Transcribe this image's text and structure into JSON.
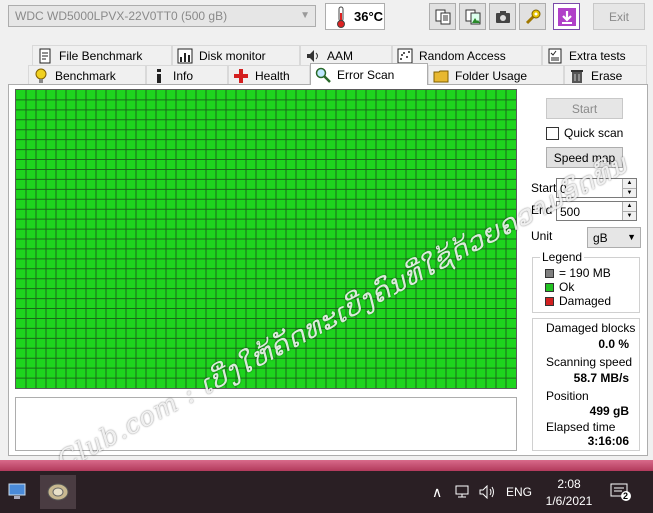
{
  "window": {
    "drive": "WDC WD5000LPVX-22V0TT0 (500 gB)",
    "temperature": "36",
    "temperature_unit": "°C",
    "exit_label": "Exit"
  },
  "tabs_row1": [
    {
      "label": "File Benchmark",
      "icon": "file-benchmark-icon"
    },
    {
      "label": "Disk monitor",
      "icon": "disk-monitor-icon"
    },
    {
      "label": "AAM",
      "icon": "speaker-icon"
    },
    {
      "label": "Random Access",
      "icon": "random-access-icon"
    },
    {
      "label": "Extra tests",
      "icon": "extra-tests-icon"
    }
  ],
  "tabs_row2": [
    {
      "label": "Benchmark",
      "icon": "benchmark-icon"
    },
    {
      "label": "Info",
      "icon": "info-icon"
    },
    {
      "label": "Health",
      "icon": "health-icon"
    },
    {
      "label": "Error Scan",
      "icon": "magnifier-icon",
      "active": true
    },
    {
      "label": "Folder Usage",
      "icon": "folder-icon"
    },
    {
      "label": "Erase",
      "icon": "trash-icon"
    }
  ],
  "scan": {
    "start_label": "Start",
    "quick_scan_label": "Quick scan",
    "speed_map_label": "Speed map",
    "start_field_label": "Start",
    "start_value": "0",
    "end_field_label": "End",
    "end_value": "500",
    "unit_label": "Unit",
    "unit_value": "gB",
    "grid_columns": 50,
    "grid_rows": 30,
    "ok_color": "#1ed41e"
  },
  "legend": {
    "title": "Legend",
    "items": [
      {
        "label": "= 190 MB",
        "color": "#808080"
      },
      {
        "label": "Ok",
        "color": "#22c322"
      },
      {
        "label": "Damaged",
        "color": "#d22020"
      }
    ]
  },
  "stats": {
    "damaged_blocks_label": "Damaged blocks",
    "damaged_blocks_value": "0.0 %",
    "scanning_speed_label": "Scanning speed",
    "scanning_speed_value": "58.7 MB/s",
    "position_label": "Position",
    "position_value": "499 gB",
    "elapsed_label": "Elapsed time",
    "elapsed_value": "3:16:06"
  },
  "watermark": "Cn-Club.com : ເບີ່ງໃຫ້ຄັດທະເບີ່ງຄົນທີ່ໃຊ້ດ້ວຍຄວາມອົດທົນ",
  "taskbar": {
    "language": "ENG",
    "time": "2:08",
    "date": "1/6/2021",
    "notifications": "2"
  }
}
